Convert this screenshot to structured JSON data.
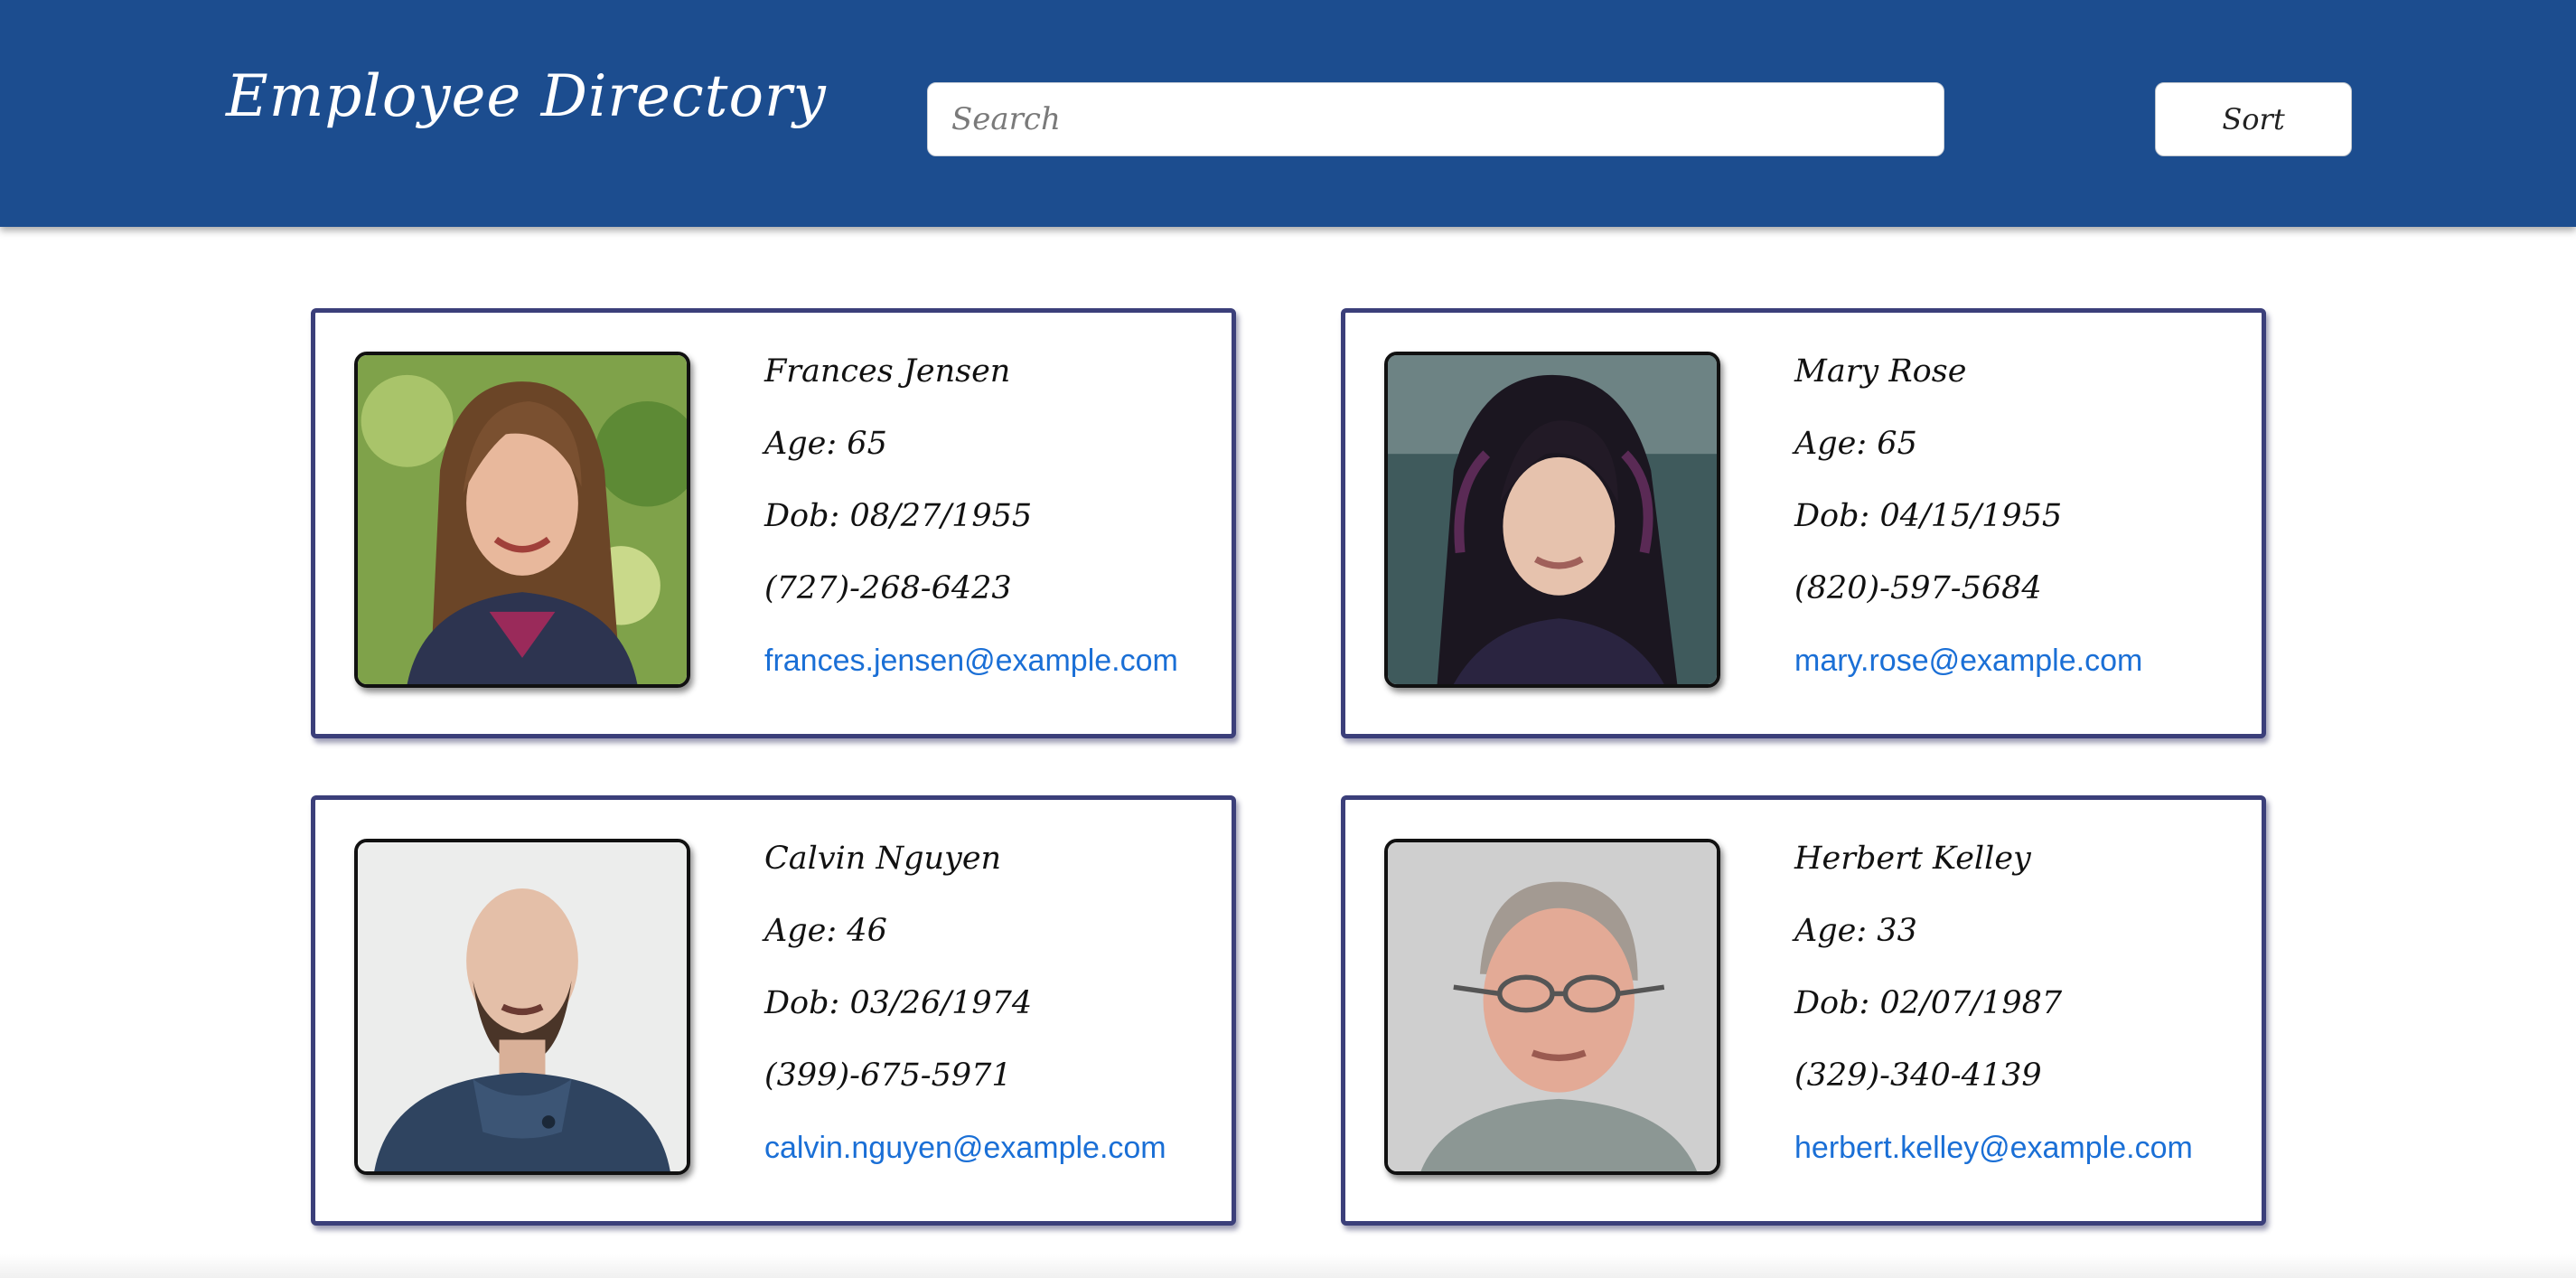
{
  "header": {
    "title": "Employee Directory",
    "search_placeholder": "Search",
    "sort_label": "Sort",
    "background_color": "#1c4d8f"
  },
  "employees": [
    {
      "name": "Frances Jensen",
      "age": "Age: 65",
      "dob": "Dob:  08/27/1955",
      "phone": "(727)-268-6423",
      "email": "frances.jensen@example.com",
      "photo_icon": "portrait-woman-brown-hair"
    },
    {
      "name": "Mary Rose",
      "age": "Age: 65",
      "dob": "Dob:  04/15/1955",
      "phone": "(820)-597-5684",
      "email": "mary.rose@example.com",
      "photo_icon": "portrait-woman-dark-hair"
    },
    {
      "name": "Calvin Nguyen",
      "age": "Age: 46",
      "dob": "Dob:  03/26/1974",
      "phone": "(399)-675-5971",
      "email": "calvin.nguyen@example.com",
      "photo_icon": "portrait-man-bald-beard"
    },
    {
      "name": "Herbert Kelley",
      "age": "Age: 33",
      "dob": "Dob:  02/07/1987",
      "phone": "(329)-340-4139",
      "email": "herbert.kelley@example.com",
      "photo_icon": "portrait-man-glasses"
    }
  ],
  "colors": {
    "card_border": "#3b3f7a",
    "link": "#1a6fd6"
  }
}
